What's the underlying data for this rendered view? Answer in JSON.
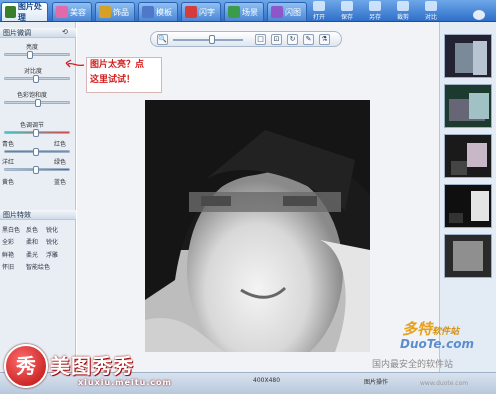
{
  "tabs": [
    {
      "label": "图片处理",
      "icon": "picture-icon",
      "color": "#3a7d2a"
    },
    {
      "label": "美容",
      "icon": "beauty-icon",
      "color": "#e26aa8"
    },
    {
      "label": "饰品",
      "icon": "ornament-icon",
      "color": "#d4a126"
    },
    {
      "label": "模板",
      "icon": "template-icon",
      "color": "#4f78c9"
    },
    {
      "label": "闪字",
      "icon": "flash-text-icon",
      "color": "#d63c3c"
    },
    {
      "label": "场景",
      "icon": "scene-icon",
      "color": "#3a9b4a"
    },
    {
      "label": "闪图",
      "icon": "flash-image-icon",
      "color": "#8d56c9"
    }
  ],
  "toolbar": {
    "open": "打开",
    "save": "保存",
    "save_as": "另存",
    "crop": "裁剪",
    "compare": "对比"
  },
  "left_panel": {
    "adjust_title": "图片微调",
    "brightness": "亮度",
    "contrast": "对比度",
    "saturation": "色彩饱和度",
    "color_adjust": "色调调节",
    "cyan": "青色",
    "red": "红色",
    "magenta": "洋红",
    "green": "绿色",
    "yellow": "黄色",
    "blue": "蓝色",
    "effects_title": "图片特效",
    "effects": [
      [
        "黑白色",
        "反色",
        "锐化"
      ],
      [
        "全彩",
        "柔和",
        "锐化"
      ],
      [
        "鲜艳",
        "柔光",
        "浮雕"
      ],
      [
        "怀旧",
        "智能绘色",
        ""
      ]
    ]
  },
  "callout": {
    "line1": "图片太亮？点",
    "line2": "这里试试！"
  },
  "status": {
    "size": "400X480",
    "mode": "图片操作"
  },
  "branding": {
    "logo_char": "秀",
    "name": "美图秀秀",
    "url": "xiuxiu.meitu.com"
  },
  "watermark": {
    "brand": "多特",
    "brand_suffix": "软件站",
    "domain": "DuoTe.com",
    "slogan": "国内最安全的软件站",
    "small": "www.duote.com"
  },
  "colors": {
    "accent": "#2f6fc9",
    "callout_text": "#d51d1d"
  }
}
